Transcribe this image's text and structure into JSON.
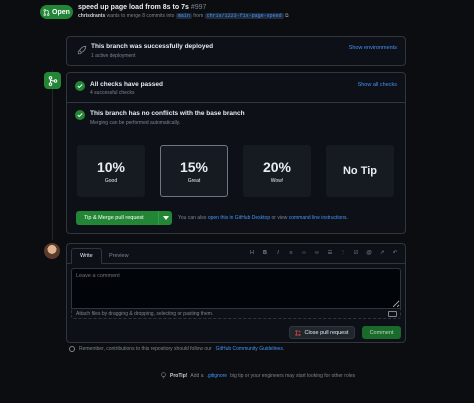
{
  "header": {
    "status": "Open",
    "title": "speed up page load from 8s to 7s",
    "number": "#997",
    "author": "chrisdrants",
    "merge_text": "wants to merge 8 commits into",
    "base_branch": "main",
    "from_text": "from",
    "head_branch": "chris/1223-fix-page-speed"
  },
  "deployment": {
    "title": "This branch was successfully deployed",
    "subtitle": "1 active deployment",
    "link": "Show environments"
  },
  "checks": {
    "title": "All checks have passed",
    "subtitle": "4 successful checks",
    "link": "Show all checks"
  },
  "conflicts": {
    "title": "This branch has no conflicts with the base branch",
    "subtitle": "Merging can be performed automatically."
  },
  "tips": [
    {
      "percent": "10%",
      "label": "Good"
    },
    {
      "percent": "15%",
      "label": "Great"
    },
    {
      "percent": "20%",
      "label": "Wow!"
    },
    {
      "percent": "No Tip",
      "label": ""
    }
  ],
  "merge": {
    "button": "Tip & Merge pull request",
    "note_prefix": "You can also",
    "note_link1": "open this in GitHub Desktop",
    "note_mid": "or view",
    "note_link2": "command line instructions."
  },
  "comment": {
    "tab_write": "Write",
    "tab_preview": "Preview",
    "placeholder": "Leave a comment",
    "attach": "Attach files by dragging & dropping, selecting or pasting them.",
    "close_button": "Close pull request",
    "comment_button": "Comment"
  },
  "remember": {
    "prefix": "Remember, contributions to this repository should follow our",
    "link": "GitHub Community Guidelines."
  },
  "protip": {
    "label": "ProTip!",
    "prefix": "Add a",
    "link": ".gitignore",
    "suffix": "big tip or your engineers may start looking for other roles"
  },
  "colors": {
    "accent_green": "#238636",
    "link_blue": "#4493f8",
    "background": "#0b0d10"
  }
}
